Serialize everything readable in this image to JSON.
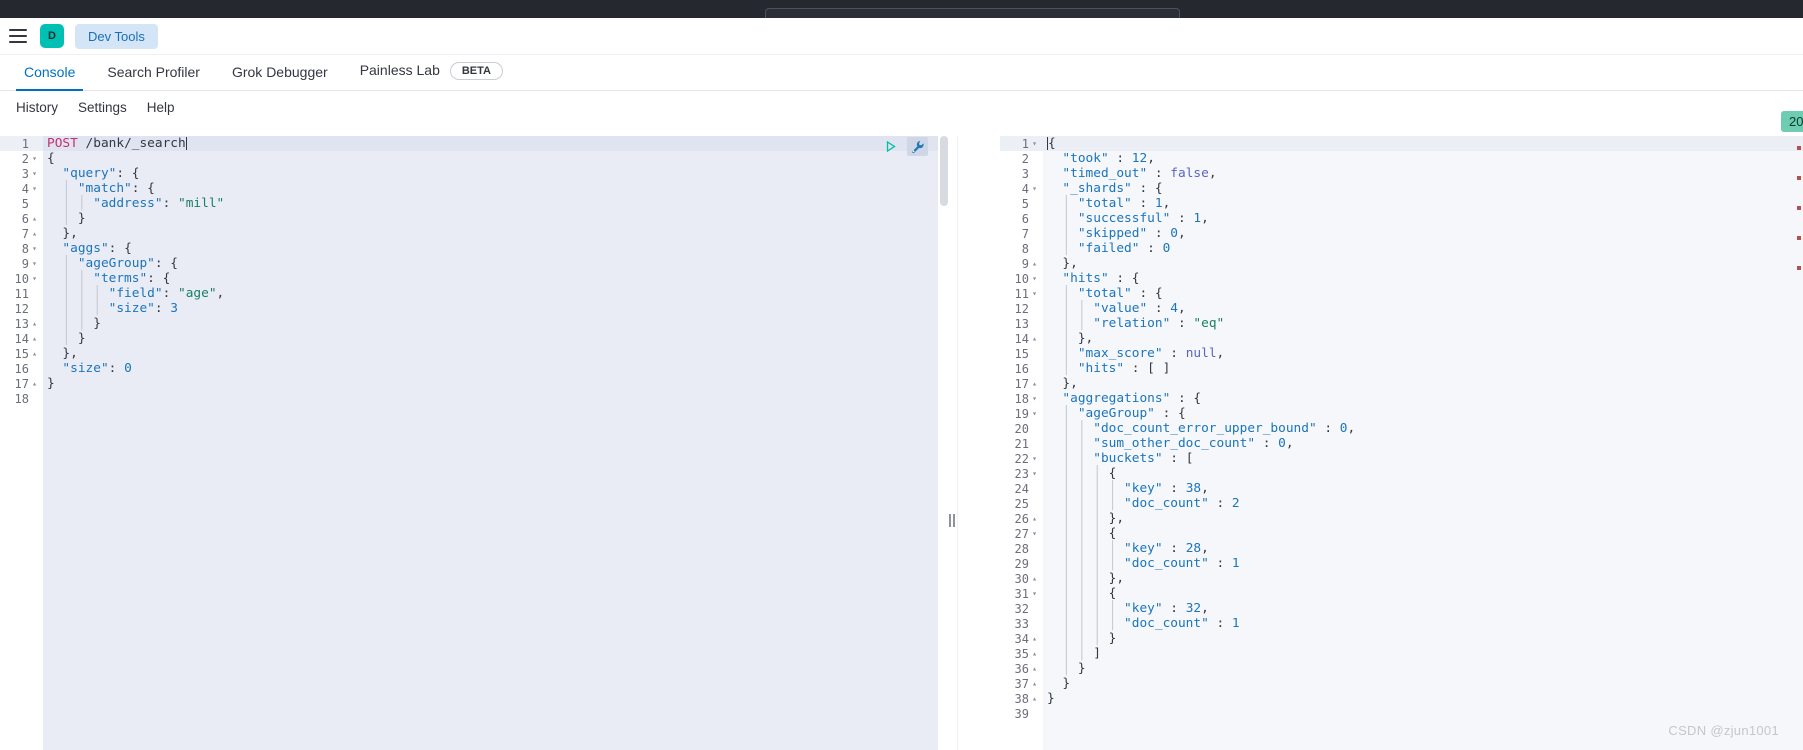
{
  "window": {
    "chrome_bar_color": "#25282f",
    "search_placeholder": ""
  },
  "header": {
    "menu_icon": "hamburger-icon",
    "space_initial": "D",
    "breadcrumb": "Dev Tools",
    "breadcrumb_bg": "#d3e5f7",
    "breadcrumb_fg": "#1a6fb8",
    "space_avatar_bg": "#00bfb3"
  },
  "tabs": [
    {
      "label": "Console",
      "active": true,
      "badge": null
    },
    {
      "label": "Search Profiler",
      "active": false,
      "badge": null
    },
    {
      "label": "Grok Debugger",
      "active": false,
      "badge": null
    },
    {
      "label": "Painless Lab",
      "active": false,
      "badge": "BETA"
    }
  ],
  "console_menu": [
    {
      "label": "History"
    },
    {
      "label": "Settings"
    },
    {
      "label": "Help"
    }
  ],
  "top_right_badge": {
    "label": "20",
    "bg": "#6dccb1"
  },
  "accent_color": "#0071c2",
  "request_editor": {
    "name": "console-request-editor",
    "actions": [
      {
        "name": "send-request-play-icon",
        "title": "click to send request"
      },
      {
        "name": "wrench-icon",
        "title": "open documentation / auto indent"
      }
    ],
    "cursor_line": 1,
    "lines": [
      {
        "n": 1,
        "fold": "",
        "tokens": [
          {
            "t": "method",
            "v": "POST"
          },
          {
            "t": "punc",
            "v": " "
          },
          {
            "t": "url",
            "v": "/bank/_search"
          },
          {
            "t": "caret",
            "v": ""
          }
        ]
      },
      {
        "n": 2,
        "fold": "▾",
        "tokens": [
          {
            "t": "punc",
            "v": "{"
          }
        ]
      },
      {
        "n": 3,
        "fold": "▾",
        "tokens": [
          {
            "t": "punc",
            "v": "  "
          },
          {
            "t": "key",
            "v": "\"query\""
          },
          {
            "t": "punc",
            "v": ": {"
          }
        ]
      },
      {
        "n": 4,
        "fold": "▾",
        "tokens": [
          {
            "t": "guide",
            "v": "  │ "
          },
          {
            "t": "key",
            "v": "\"match\""
          },
          {
            "t": "punc",
            "v": ": {"
          }
        ]
      },
      {
        "n": 5,
        "fold": "",
        "tokens": [
          {
            "t": "guide",
            "v": "  │ │ "
          },
          {
            "t": "key",
            "v": "\"address\""
          },
          {
            "t": "punc",
            "v": ": "
          },
          {
            "t": "str",
            "v": "\"mill\""
          }
        ]
      },
      {
        "n": 6,
        "fold": "▴",
        "tokens": [
          {
            "t": "guide",
            "v": "  │ "
          },
          {
            "t": "punc",
            "v": "}"
          }
        ]
      },
      {
        "n": 7,
        "fold": "▴",
        "tokens": [
          {
            "t": "punc",
            "v": "  },"
          }
        ]
      },
      {
        "n": 8,
        "fold": "▾",
        "tokens": [
          {
            "t": "punc",
            "v": "  "
          },
          {
            "t": "key",
            "v": "\"aggs\""
          },
          {
            "t": "punc",
            "v": ": {"
          }
        ]
      },
      {
        "n": 9,
        "fold": "▾",
        "tokens": [
          {
            "t": "guide",
            "v": "  │ "
          },
          {
            "t": "key",
            "v": "\"ageGroup\""
          },
          {
            "t": "punc",
            "v": ": {"
          }
        ]
      },
      {
        "n": 10,
        "fold": "▾",
        "tokens": [
          {
            "t": "guide",
            "v": "  │ │ "
          },
          {
            "t": "key",
            "v": "\"terms\""
          },
          {
            "t": "punc",
            "v": ": {"
          }
        ]
      },
      {
        "n": 11,
        "fold": "",
        "tokens": [
          {
            "t": "guide",
            "v": "  │ │ │ "
          },
          {
            "t": "key",
            "v": "\"field\""
          },
          {
            "t": "punc",
            "v": ": "
          },
          {
            "t": "str",
            "v": "\"age\""
          },
          {
            "t": "punc",
            "v": ","
          }
        ]
      },
      {
        "n": 12,
        "fold": "",
        "tokens": [
          {
            "t": "guide",
            "v": "  │ │ │ "
          },
          {
            "t": "key",
            "v": "\"size\""
          },
          {
            "t": "punc",
            "v": ": "
          },
          {
            "t": "num",
            "v": "3"
          }
        ]
      },
      {
        "n": 13,
        "fold": "▴",
        "tokens": [
          {
            "t": "guide",
            "v": "  │ │ "
          },
          {
            "t": "punc",
            "v": "}"
          }
        ]
      },
      {
        "n": 14,
        "fold": "▴",
        "tokens": [
          {
            "t": "guide",
            "v": "  │ "
          },
          {
            "t": "punc",
            "v": "}"
          }
        ]
      },
      {
        "n": 15,
        "fold": "▴",
        "tokens": [
          {
            "t": "punc",
            "v": "  },"
          }
        ]
      },
      {
        "n": 16,
        "fold": "",
        "tokens": [
          {
            "t": "punc",
            "v": "  "
          },
          {
            "t": "key",
            "v": "\"size\""
          },
          {
            "t": "punc",
            "v": ": "
          },
          {
            "t": "num",
            "v": "0"
          }
        ]
      },
      {
        "n": 17,
        "fold": "▴",
        "tokens": [
          {
            "t": "punc",
            "v": "}"
          }
        ]
      },
      {
        "n": 18,
        "fold": "",
        "tokens": []
      }
    ]
  },
  "response_editor": {
    "name": "console-response-viewer",
    "cursor_line": 1,
    "lines": [
      {
        "n": 1,
        "fold": "▾",
        "tokens": [
          {
            "t": "caret",
            "v": ""
          },
          {
            "t": "punc",
            "v": "{"
          }
        ]
      },
      {
        "n": 2,
        "fold": "",
        "tokens": [
          {
            "t": "punc",
            "v": "  "
          },
          {
            "t": "key",
            "v": "\"took\""
          },
          {
            "t": "punc",
            "v": " : "
          },
          {
            "t": "num",
            "v": "12"
          },
          {
            "t": "punc",
            "v": ","
          }
        ]
      },
      {
        "n": 3,
        "fold": "",
        "tokens": [
          {
            "t": "punc",
            "v": "  "
          },
          {
            "t": "key",
            "v": "\"timed_out\""
          },
          {
            "t": "punc",
            "v": " : "
          },
          {
            "t": "kw",
            "v": "false"
          },
          {
            "t": "punc",
            "v": ","
          }
        ]
      },
      {
        "n": 4,
        "fold": "▾",
        "tokens": [
          {
            "t": "punc",
            "v": "  "
          },
          {
            "t": "key",
            "v": "\"_shards\""
          },
          {
            "t": "punc",
            "v": " : {"
          }
        ]
      },
      {
        "n": 5,
        "fold": "",
        "tokens": [
          {
            "t": "guide",
            "v": "  │ "
          },
          {
            "t": "key",
            "v": "\"total\""
          },
          {
            "t": "punc",
            "v": " : "
          },
          {
            "t": "num",
            "v": "1"
          },
          {
            "t": "punc",
            "v": ","
          }
        ]
      },
      {
        "n": 6,
        "fold": "",
        "tokens": [
          {
            "t": "guide",
            "v": "  │ "
          },
          {
            "t": "key",
            "v": "\"successful\""
          },
          {
            "t": "punc",
            "v": " : "
          },
          {
            "t": "num",
            "v": "1"
          },
          {
            "t": "punc",
            "v": ","
          }
        ]
      },
      {
        "n": 7,
        "fold": "",
        "tokens": [
          {
            "t": "guide",
            "v": "  │ "
          },
          {
            "t": "key",
            "v": "\"skipped\""
          },
          {
            "t": "punc",
            "v": " : "
          },
          {
            "t": "num",
            "v": "0"
          },
          {
            "t": "punc",
            "v": ","
          }
        ]
      },
      {
        "n": 8,
        "fold": "",
        "tokens": [
          {
            "t": "guide",
            "v": "  │ "
          },
          {
            "t": "key",
            "v": "\"failed\""
          },
          {
            "t": "punc",
            "v": " : "
          },
          {
            "t": "num",
            "v": "0"
          }
        ]
      },
      {
        "n": 9,
        "fold": "▴",
        "tokens": [
          {
            "t": "punc",
            "v": "  },"
          }
        ]
      },
      {
        "n": 10,
        "fold": "▾",
        "tokens": [
          {
            "t": "punc",
            "v": "  "
          },
          {
            "t": "key",
            "v": "\"hits\""
          },
          {
            "t": "punc",
            "v": " : {"
          }
        ]
      },
      {
        "n": 11,
        "fold": "▾",
        "tokens": [
          {
            "t": "guide",
            "v": "  │ "
          },
          {
            "t": "key",
            "v": "\"total\""
          },
          {
            "t": "punc",
            "v": " : {"
          }
        ]
      },
      {
        "n": 12,
        "fold": "",
        "tokens": [
          {
            "t": "guide",
            "v": "  │ │ "
          },
          {
            "t": "key",
            "v": "\"value\""
          },
          {
            "t": "punc",
            "v": " : "
          },
          {
            "t": "num",
            "v": "4"
          },
          {
            "t": "punc",
            "v": ","
          }
        ]
      },
      {
        "n": 13,
        "fold": "",
        "tokens": [
          {
            "t": "guide",
            "v": "  │ │ "
          },
          {
            "t": "key",
            "v": "\"relation\""
          },
          {
            "t": "punc",
            "v": " : "
          },
          {
            "t": "str",
            "v": "\"eq\""
          }
        ]
      },
      {
        "n": 14,
        "fold": "▴",
        "tokens": [
          {
            "t": "guide",
            "v": "  │ "
          },
          {
            "t": "punc",
            "v": "},"
          }
        ]
      },
      {
        "n": 15,
        "fold": "",
        "tokens": [
          {
            "t": "guide",
            "v": "  │ "
          },
          {
            "t": "key",
            "v": "\"max_score\""
          },
          {
            "t": "punc",
            "v": " : "
          },
          {
            "t": "kw",
            "v": "null"
          },
          {
            "t": "punc",
            "v": ","
          }
        ]
      },
      {
        "n": 16,
        "fold": "",
        "tokens": [
          {
            "t": "guide",
            "v": "  │ "
          },
          {
            "t": "key",
            "v": "\"hits\""
          },
          {
            "t": "punc",
            "v": " : [ ]"
          }
        ]
      },
      {
        "n": 17,
        "fold": "▴",
        "tokens": [
          {
            "t": "punc",
            "v": "  },"
          }
        ]
      },
      {
        "n": 18,
        "fold": "▾",
        "tokens": [
          {
            "t": "punc",
            "v": "  "
          },
          {
            "t": "key",
            "v": "\"aggregations\""
          },
          {
            "t": "punc",
            "v": " : {"
          }
        ]
      },
      {
        "n": 19,
        "fold": "▾",
        "tokens": [
          {
            "t": "guide",
            "v": "  │ "
          },
          {
            "t": "key",
            "v": "\"ageGroup\""
          },
          {
            "t": "punc",
            "v": " : {"
          }
        ]
      },
      {
        "n": 20,
        "fold": "",
        "tokens": [
          {
            "t": "guide",
            "v": "  │ │ "
          },
          {
            "t": "key",
            "v": "\"doc_count_error_upper_bound\""
          },
          {
            "t": "punc",
            "v": " : "
          },
          {
            "t": "num",
            "v": "0"
          },
          {
            "t": "punc",
            "v": ","
          }
        ]
      },
      {
        "n": 21,
        "fold": "",
        "tokens": [
          {
            "t": "guide",
            "v": "  │ │ "
          },
          {
            "t": "key",
            "v": "\"sum_other_doc_count\""
          },
          {
            "t": "punc",
            "v": " : "
          },
          {
            "t": "num",
            "v": "0"
          },
          {
            "t": "punc",
            "v": ","
          }
        ]
      },
      {
        "n": 22,
        "fold": "▾",
        "tokens": [
          {
            "t": "guide",
            "v": "  │ │ "
          },
          {
            "t": "key",
            "v": "\"buckets\""
          },
          {
            "t": "punc",
            "v": " : ["
          }
        ]
      },
      {
        "n": 23,
        "fold": "▾",
        "tokens": [
          {
            "t": "guide",
            "v": "  │ │ │ "
          },
          {
            "t": "punc",
            "v": "{"
          }
        ]
      },
      {
        "n": 24,
        "fold": "",
        "tokens": [
          {
            "t": "guide",
            "v": "  │ │ │ │ "
          },
          {
            "t": "key",
            "v": "\"key\""
          },
          {
            "t": "punc",
            "v": " : "
          },
          {
            "t": "num",
            "v": "38"
          },
          {
            "t": "punc",
            "v": ","
          }
        ]
      },
      {
        "n": 25,
        "fold": "",
        "tokens": [
          {
            "t": "guide",
            "v": "  │ │ │ │ "
          },
          {
            "t": "key",
            "v": "\"doc_count\""
          },
          {
            "t": "punc",
            "v": " : "
          },
          {
            "t": "num",
            "v": "2"
          }
        ]
      },
      {
        "n": 26,
        "fold": "▴",
        "tokens": [
          {
            "t": "guide",
            "v": "  │ │ │ "
          },
          {
            "t": "punc",
            "v": "},"
          }
        ]
      },
      {
        "n": 27,
        "fold": "▾",
        "tokens": [
          {
            "t": "guide",
            "v": "  │ │ │ "
          },
          {
            "t": "punc",
            "v": "{"
          }
        ]
      },
      {
        "n": 28,
        "fold": "",
        "tokens": [
          {
            "t": "guide",
            "v": "  │ │ │ │ "
          },
          {
            "t": "key",
            "v": "\"key\""
          },
          {
            "t": "punc",
            "v": " : "
          },
          {
            "t": "num",
            "v": "28"
          },
          {
            "t": "punc",
            "v": ","
          }
        ]
      },
      {
        "n": 29,
        "fold": "",
        "tokens": [
          {
            "t": "guide",
            "v": "  │ │ │ │ "
          },
          {
            "t": "key",
            "v": "\"doc_count\""
          },
          {
            "t": "punc",
            "v": " : "
          },
          {
            "t": "num",
            "v": "1"
          }
        ]
      },
      {
        "n": 30,
        "fold": "▴",
        "tokens": [
          {
            "t": "guide",
            "v": "  │ │ │ "
          },
          {
            "t": "punc",
            "v": "},"
          }
        ]
      },
      {
        "n": 31,
        "fold": "▾",
        "tokens": [
          {
            "t": "guide",
            "v": "  │ │ │ "
          },
          {
            "t": "punc",
            "v": "{"
          }
        ]
      },
      {
        "n": 32,
        "fold": "",
        "tokens": [
          {
            "t": "guide",
            "v": "  │ │ │ │ "
          },
          {
            "t": "key",
            "v": "\"key\""
          },
          {
            "t": "punc",
            "v": " : "
          },
          {
            "t": "num",
            "v": "32"
          },
          {
            "t": "punc",
            "v": ","
          }
        ]
      },
      {
        "n": 33,
        "fold": "",
        "tokens": [
          {
            "t": "guide",
            "v": "  │ │ │ │ "
          },
          {
            "t": "key",
            "v": "\"doc_count\""
          },
          {
            "t": "punc",
            "v": " : "
          },
          {
            "t": "num",
            "v": "1"
          }
        ]
      },
      {
        "n": 34,
        "fold": "▴",
        "tokens": [
          {
            "t": "guide",
            "v": "  │ │ │ "
          },
          {
            "t": "punc",
            "v": "}"
          }
        ]
      },
      {
        "n": 35,
        "fold": "▴",
        "tokens": [
          {
            "t": "guide",
            "v": "  │ │ "
          },
          {
            "t": "punc",
            "v": "]"
          }
        ]
      },
      {
        "n": 36,
        "fold": "▴",
        "tokens": [
          {
            "t": "guide",
            "v": "  │ "
          },
          {
            "t": "punc",
            "v": "}"
          }
        ]
      },
      {
        "n": 37,
        "fold": "▴",
        "tokens": [
          {
            "t": "punc",
            "v": "  }"
          }
        ]
      },
      {
        "n": 38,
        "fold": "▴",
        "tokens": [
          {
            "t": "punc",
            "v": "}"
          }
        ]
      },
      {
        "n": 39,
        "fold": "",
        "tokens": []
      }
    ]
  },
  "resize_handle": {
    "name": "pane-resize-handle"
  },
  "watermark": "CSDN @zjun1001"
}
